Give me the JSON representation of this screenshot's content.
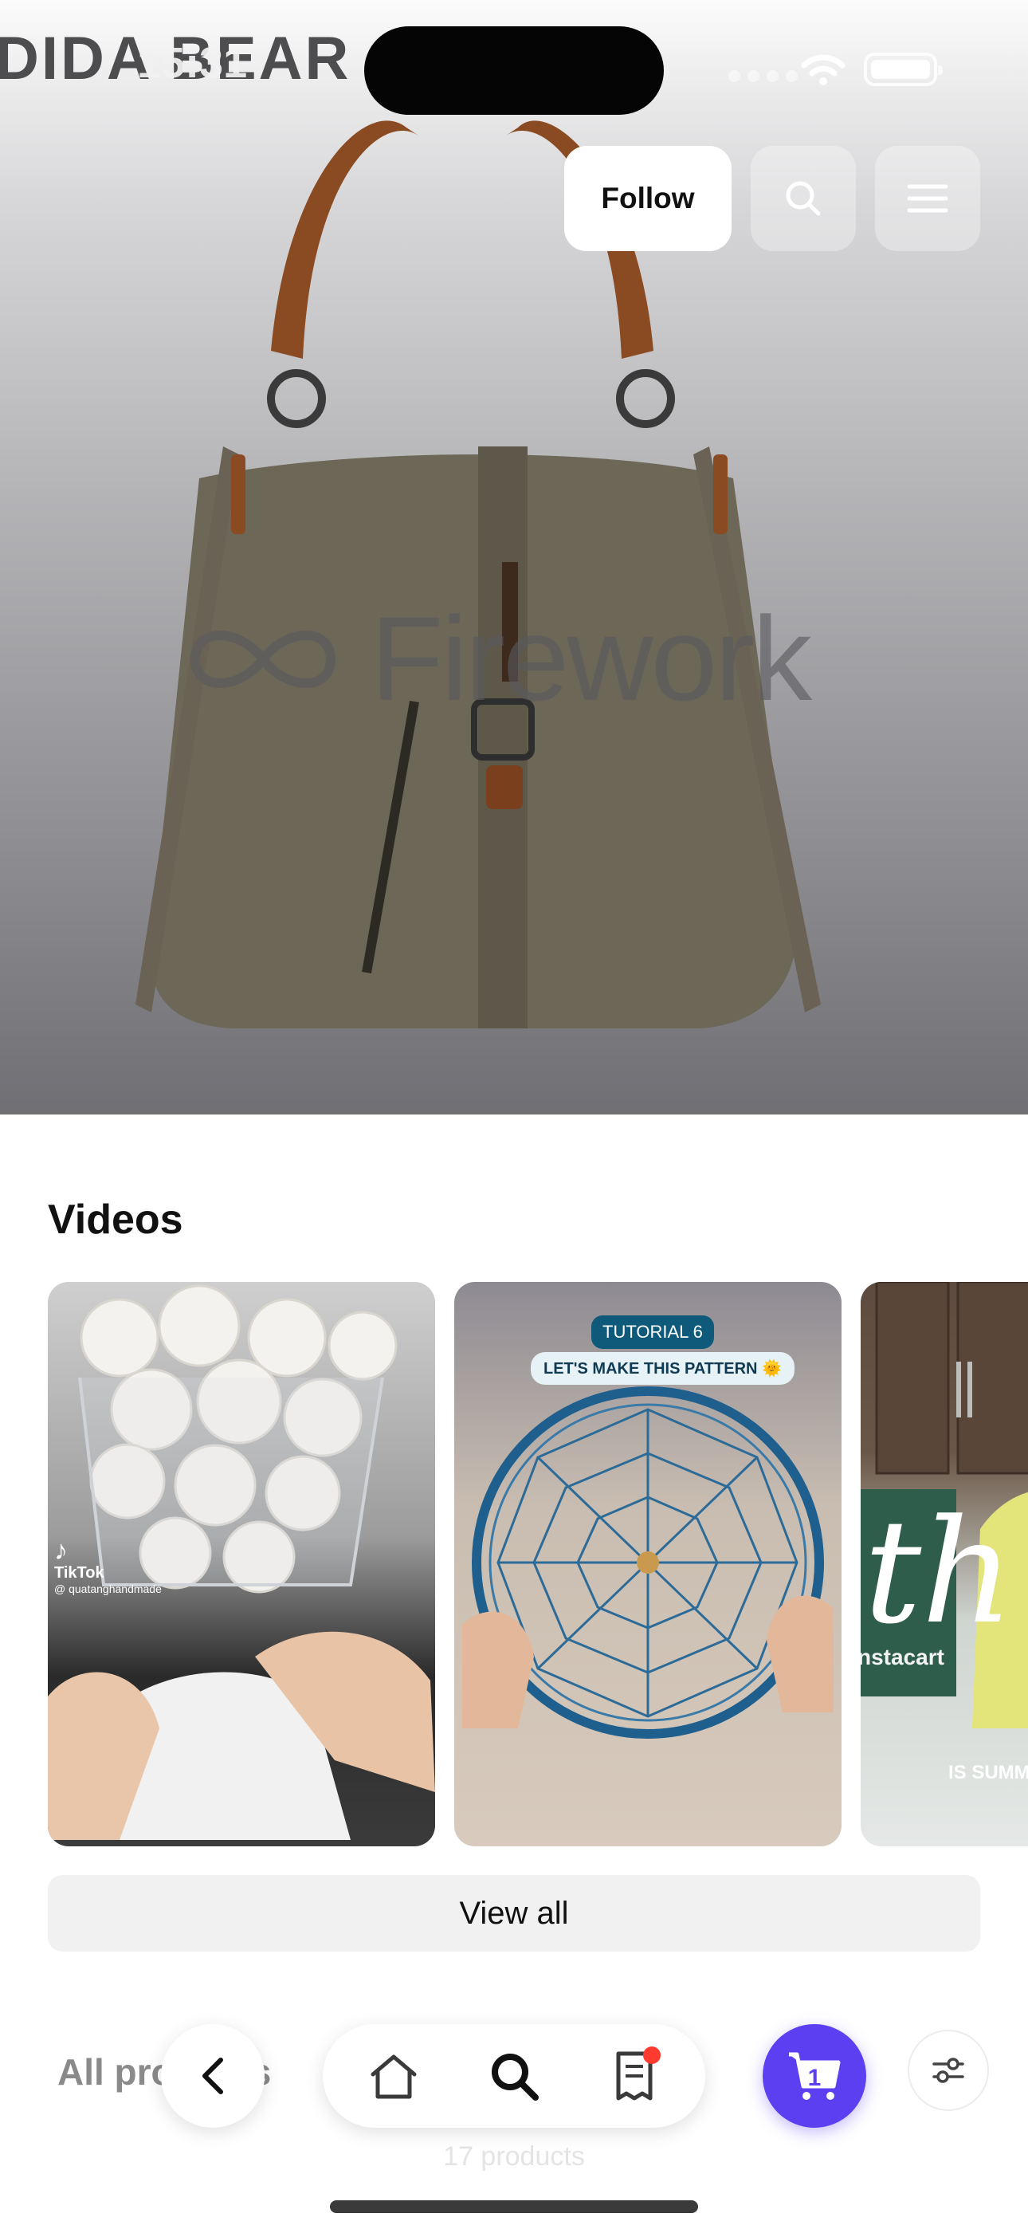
{
  "status_bar": {
    "time": "15:31"
  },
  "store": {
    "name_text": "DIDA BEAR"
  },
  "header": {
    "follow_label": "Follow"
  },
  "hero": {
    "watermark": "Firework"
  },
  "videos": {
    "title": "Videos",
    "items": [
      {
        "overlay_brand": "TikTok",
        "overlay_handle": "@ quatanghandmade"
      },
      {
        "badge_top": "TUTORIAL 6",
        "badge_bottom": "LET'S MAKE THIS PATTERN 🌞"
      },
      {
        "title_script": "th",
        "store_text": "nstacart",
        "caption": "IS SUMM"
      }
    ],
    "view_all_label": "View all"
  },
  "products": {
    "heading": "All products",
    "count_label": "17 products"
  },
  "bottom_nav": {
    "cart_count": "1"
  },
  "colors": {
    "accent": "#5b3ff1",
    "badge_red": "#ff3b30"
  }
}
